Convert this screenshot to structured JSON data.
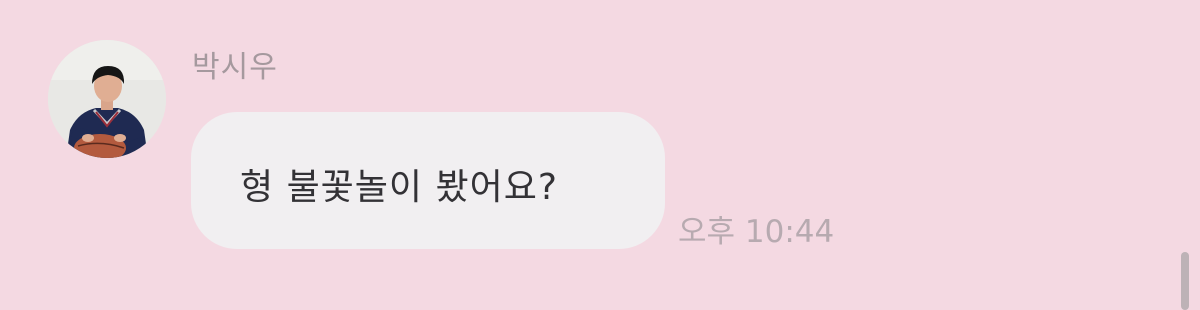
{
  "message": {
    "sender_name": "박시우",
    "text": "형 불꽃놀이 봤어요?",
    "time": "오후 10:44"
  },
  "colors": {
    "background": "#f4d9e2",
    "bubble": "#f1eff1",
    "sender_text": "#a5999e",
    "message_text": "#333236",
    "time_text": "#b7aab0"
  }
}
